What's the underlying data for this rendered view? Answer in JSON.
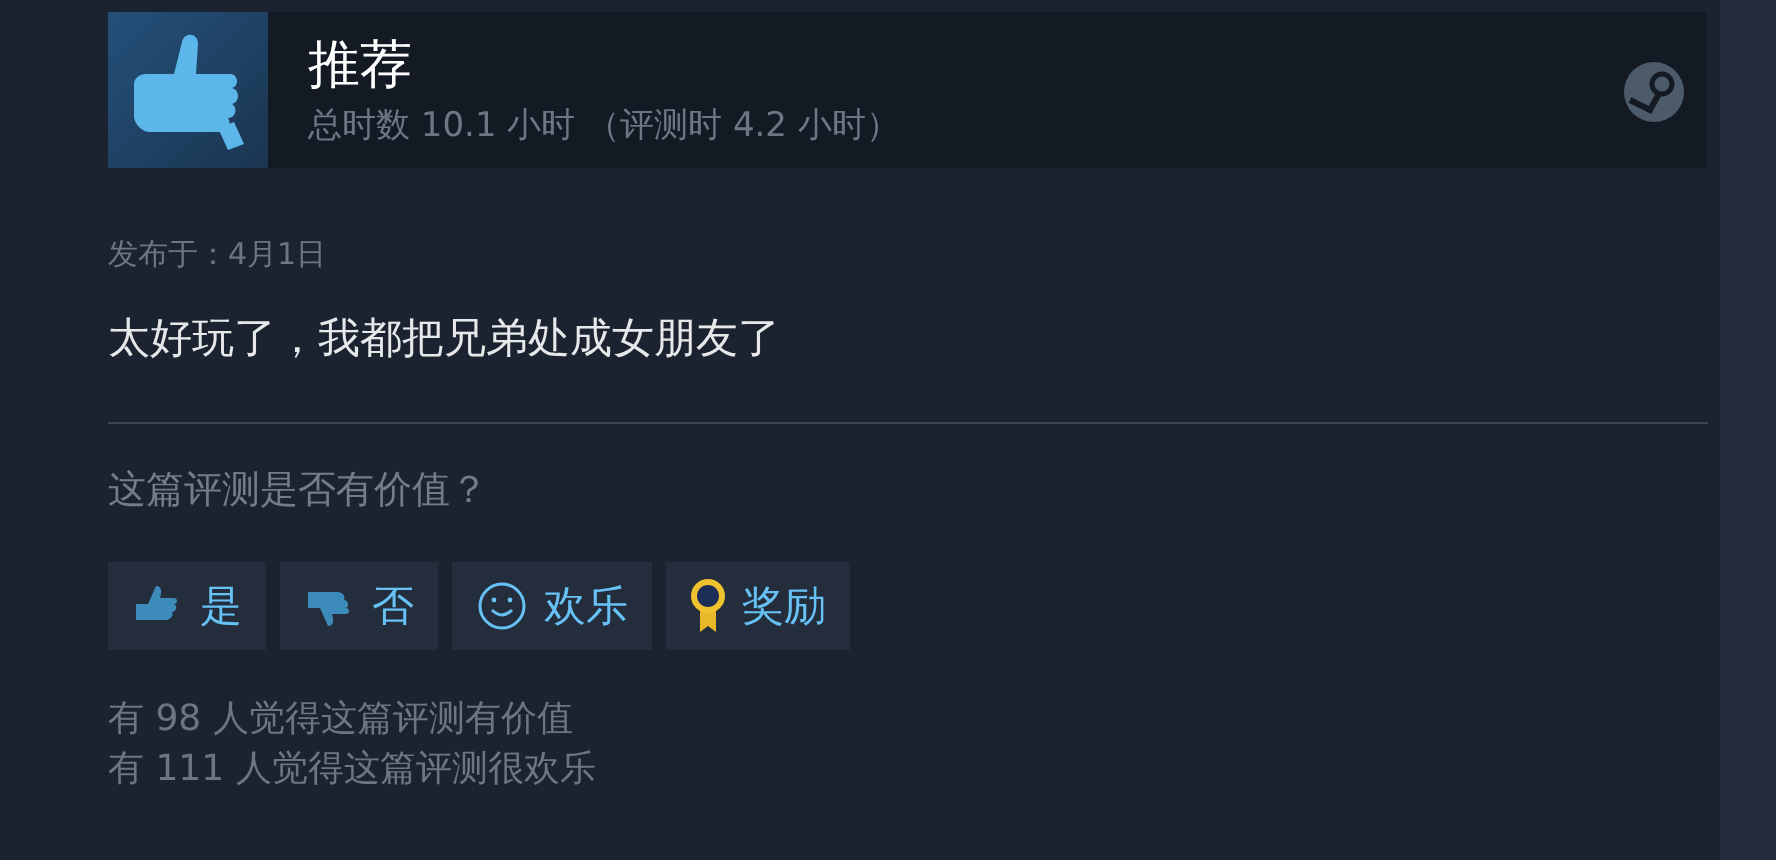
{
  "review": {
    "verdict": "推荐",
    "hours": "总时数 10.1 小时 （评测时 4.2 小时）",
    "posted": "发布于：4月1日",
    "text": "太好玩了，我都把兄弟处成女朋友了"
  },
  "helpful": {
    "question": "这篇评测是否有价值？",
    "buttons": [
      {
        "kind": "up",
        "label": "是"
      },
      {
        "kind": "down",
        "label": "否"
      },
      {
        "kind": "funny",
        "label": "欢乐"
      },
      {
        "kind": "award",
        "label": "奖励"
      }
    ],
    "stats": [
      "有 98 人觉得这篇评测有价值",
      "有 111 人觉得这篇评测很欢乐"
    ]
  }
}
